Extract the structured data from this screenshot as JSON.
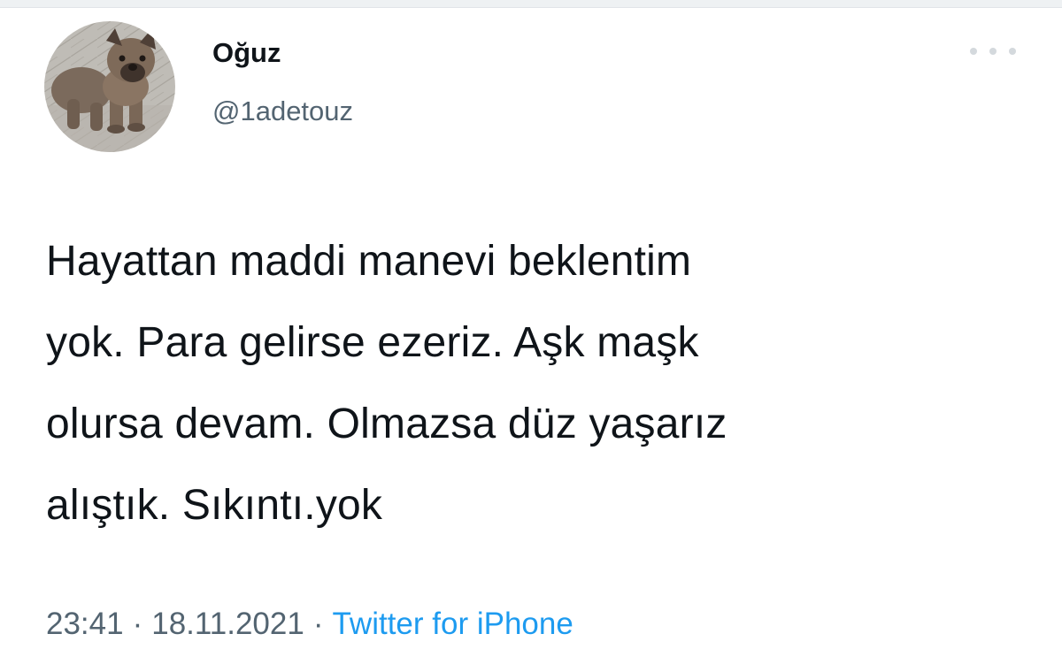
{
  "author": {
    "display_name": "Oğuz",
    "handle": "@1adetouz",
    "avatar_icon": "puppy-avatar-photo"
  },
  "more_icon": "more-horizontal-icon",
  "tweet": {
    "text": "Hayattan maddi manevi beklentim\nyok. Para gelirse ezeriz. Aşk maşk\nolursa devam. Olmazsa düz yaşarız\nalıştık. Sıkıntı.yok",
    "time": "23:41",
    "separator": "·",
    "date": "18.11.2021",
    "source": "Twitter for iPhone"
  },
  "colors": {
    "text": "#0f1419",
    "secondary": "#536471",
    "link": "#1d9bf0"
  }
}
